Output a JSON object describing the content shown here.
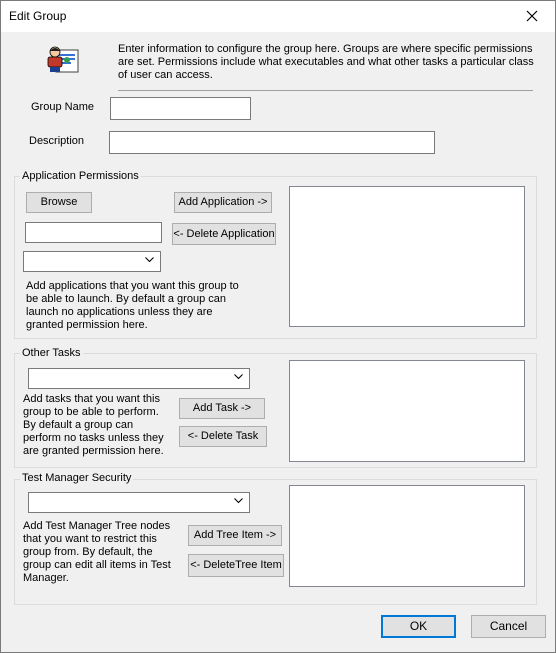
{
  "window": {
    "title": "Edit Group"
  },
  "intro": {
    "text": "Enter information to configure the group here. Groups are where specific permissions are set. Permissions include what executables and what other tasks a particular class of user can access."
  },
  "fields": {
    "group_name_label": "Group Name",
    "group_name_value": "",
    "description_label": "Description",
    "description_value": ""
  },
  "app_permissions": {
    "title": "Application Permissions",
    "browse_label": "Browse",
    "add_label": "Add Application ->",
    "delete_label": "<- Delete Application",
    "app_path_value": "",
    "combo_value": "",
    "help": "Add applications that you want this group to be able to launch. By default a group can launch no applications unless they are granted permission here."
  },
  "other_tasks": {
    "title": "Other Tasks",
    "combo_value": "",
    "add_label": "Add Task ->",
    "delete_label": "<- Delete Task",
    "help": "Add tasks that you want this group to be able to perform. By default a group can perform no tasks unless they are granted permission here."
  },
  "test_manager": {
    "title": "Test Manager Security",
    "combo_value": "",
    "add_label": "Add Tree Item ->",
    "delete_label": "<- DeleteTree Item",
    "help": "Add Test Manager Tree nodes that you want to restrict this group from. By default, the group can edit all items in Test Manager."
  },
  "footer": {
    "ok_label": "OK",
    "cancel_label": "Cancel"
  },
  "icons": {
    "close": "close-icon",
    "group": "group-users-icon",
    "dropdown": "chevron-down-icon"
  }
}
